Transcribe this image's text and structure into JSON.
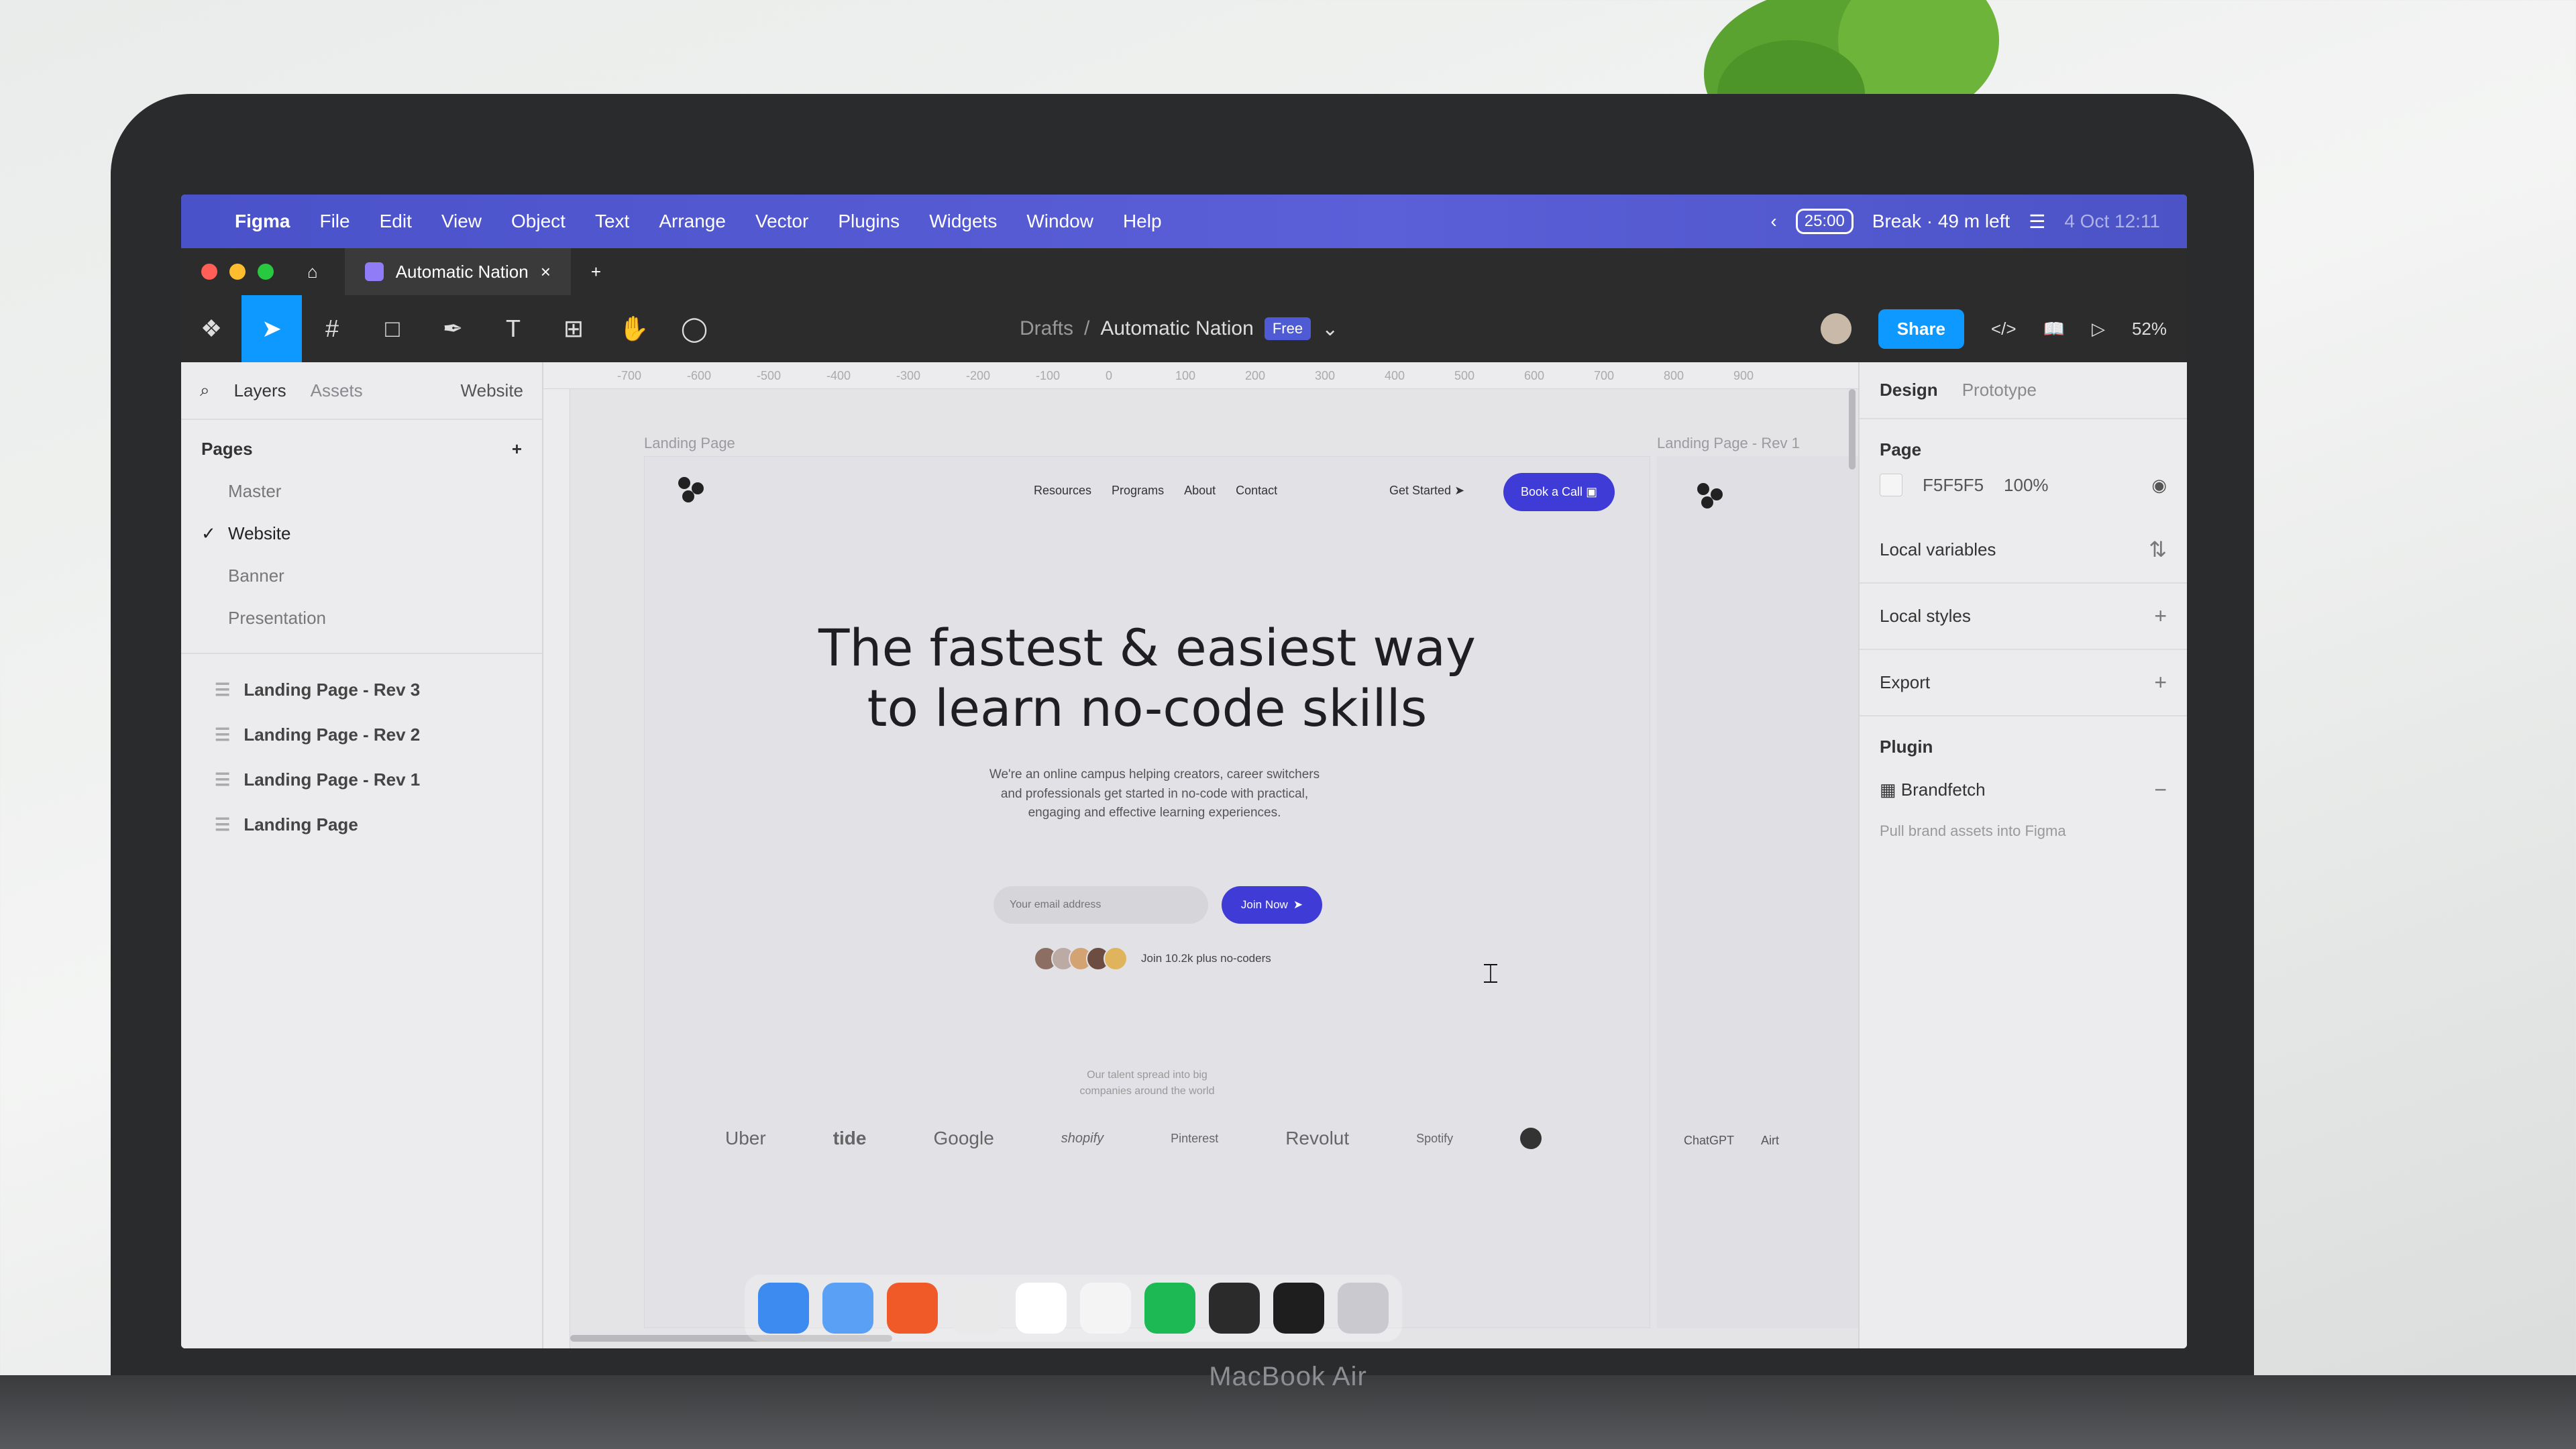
{
  "menubar": {
    "app": "Figma",
    "items": [
      "File",
      "Edit",
      "View",
      "Object",
      "Text",
      "Arrange",
      "Vector",
      "Plugins",
      "Widgets",
      "Window",
      "Help"
    ],
    "timer": "25:00",
    "status": "Break · 49 m left",
    "datetime": "4 Oct 12:11"
  },
  "tabbar": {
    "tab_title": "Automatic Nation",
    "close": "×",
    "new_tab": "+"
  },
  "toolbar": {
    "breadcrumb": "Drafts",
    "separator": "/",
    "file_name": "Automatic Nation",
    "plan_badge": "Free",
    "share": "Share",
    "zoom": "52%"
  },
  "left_panel": {
    "tabs": [
      "Layers",
      "Assets"
    ],
    "page_dropdown": "Website",
    "pages_heading": "Pages",
    "pages": [
      "Master",
      "Website",
      "Banner",
      "Presentation"
    ],
    "layers": [
      "Landing Page - Rev 3",
      "Landing Page - Rev 2",
      "Landing Page - Rev 1",
      "Landing Page"
    ]
  },
  "canvas": {
    "ruler_ticks": [
      "-700",
      "-600",
      "-500",
      "-400",
      "-300",
      "-200",
      "-100",
      "0",
      "100",
      "200",
      "300",
      "400",
      "500",
      "600",
      "700",
      "800",
      "900"
    ],
    "frame_label_main": "Landing Page",
    "frame_label_side": "Landing Page - Rev 1",
    "nav": [
      "Resources",
      "Programs",
      "About",
      "Contact"
    ],
    "get_started": "Get Started",
    "book_call": "Book a Call",
    "hero_line1": "The fastest & easiest way",
    "hero_line2": "to learn no-code skills",
    "hero_sub": "We're an online campus helping creators, career switchers and professionals get started in no-code with practical, engaging and effective learning experiences.",
    "email_placeholder": "Your email address",
    "join_button": "Join Now",
    "join_count": "Join 10.2k plus no-coders",
    "talent_line1": "Our talent spread into big",
    "talent_line2": "companies around the world",
    "logos": [
      "Uber",
      "tide",
      "Google",
      "shopify",
      "Pinterest",
      "Revolut",
      "Spotify"
    ],
    "side_logos": [
      "ChatGPT",
      "Airt"
    ]
  },
  "right_panel": {
    "tabs": [
      "Design",
      "Prototype"
    ],
    "page_heading": "Page",
    "page_color": "F5F5F5",
    "page_opacity": "100%",
    "sections": [
      "Local variables",
      "Local styles",
      "Export"
    ],
    "plugin_heading": "Plugin",
    "plugin_name": "Brandfetch",
    "plugin_desc": "Pull brand assets into Figma"
  },
  "laptop_label": "MacBook Air",
  "colors": {
    "accent": "#3f3bd6",
    "figma_blue": "#0d99ff",
    "menubar": "#5b5fd8"
  }
}
